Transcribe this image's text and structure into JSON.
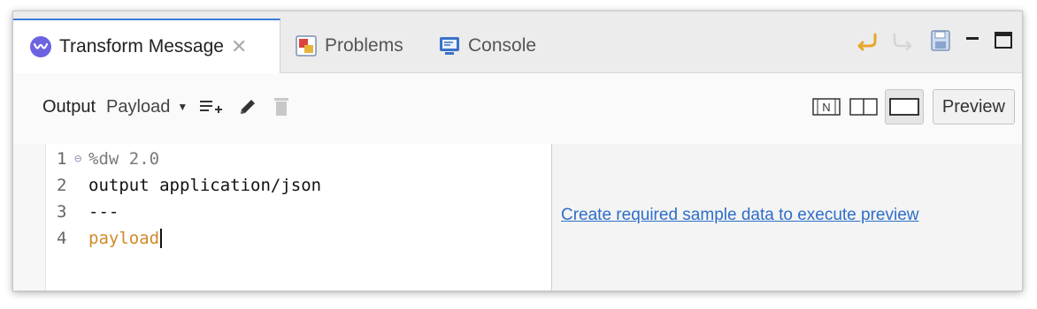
{
  "tabs": [
    {
      "label": "Transform Message",
      "icon": "dataweave-icon",
      "active": true
    },
    {
      "label": "Problems",
      "icon": "problems-icon",
      "active": false
    },
    {
      "label": "Console",
      "icon": "console-icon",
      "active": false
    }
  ],
  "window_actions": [
    "undo-icon",
    "redo-icon",
    "save-icon",
    "minimize-icon",
    "maximize-icon"
  ],
  "toolbar": {
    "output_label": "Output",
    "payload_label": "Payload",
    "preview_label": "Preview"
  },
  "editor": {
    "lines": [
      {
        "number": "1",
        "text": "%dw 2.0"
      },
      {
        "number": "2",
        "text": "output application/json"
      },
      {
        "number": "3",
        "text": "---"
      },
      {
        "number": "4",
        "text": "payload"
      }
    ]
  },
  "preview": {
    "link_text": "Create required sample data to execute preview"
  },
  "colors": {
    "accent": "#3b7bd8",
    "link": "#2d6ec9",
    "keyword": "#d08a2c",
    "undo": "#e7a82a"
  }
}
